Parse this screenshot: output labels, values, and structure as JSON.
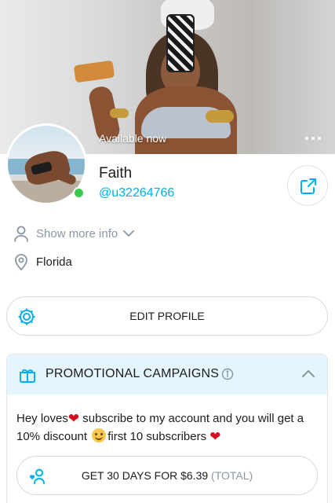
{
  "cover": {
    "status_text": "Available now"
  },
  "profile": {
    "name": "Faith",
    "handle": "@u32264766",
    "online": true,
    "show_more_label": "Show more info",
    "location": "Florida"
  },
  "actions": {
    "edit_profile_label": "EDIT PROFILE"
  },
  "promo": {
    "title": "PROMOTIONAL CAMPAIGNS",
    "message_part1": "Hey loves",
    "message_part2": " subscribe to my account and you will get a 10% discount ",
    "message_part3": "first 10 subscribers ",
    "subscribe_label": "GET 30 DAYS FOR $6.39",
    "subscribe_total": "(TOTAL)"
  },
  "colors": {
    "accent": "#00aff0",
    "online": "#3cc84f",
    "heart": "#d0101c",
    "promo_header_bg": "#e4f5fd",
    "muted_text": "#8a96a3"
  },
  "icons": {
    "more": "more-horizontal-icon",
    "share": "share-icon",
    "user": "user-icon",
    "chevron": "chevron-down-icon",
    "location": "location-pin-icon",
    "settings": "gear-icon",
    "gift": "gift-icon",
    "info": "info-icon",
    "collapse": "chevron-up-icon",
    "subscribe": "user-heart-icon"
  }
}
